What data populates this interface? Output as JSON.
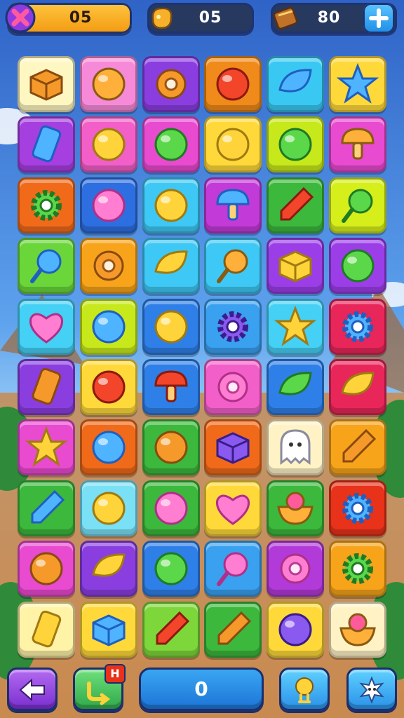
{
  "hud": {
    "lives_value": "05",
    "moves_value": "05",
    "coins_value": "80",
    "lives_icon": "close-x-icon",
    "moves_icon": "candy-bag-icon",
    "coins_icon": "chest-icon",
    "add_icon": "plus-icon"
  },
  "colors": {
    "hud_frame": "#1d3373",
    "hud_orange": "#f7a41a",
    "hud_dark": "#27395f",
    "add_blue": "#2fa3f0",
    "sky": "#3e79d6",
    "ground": "#c98a4f"
  },
  "board": {
    "rows": 10,
    "cols": 6,
    "tiles": [
      {
        "bg": "#fff7c2",
        "icon": "orange-cube-icon"
      },
      {
        "bg": "#f78ad8",
        "icon": "swirl-shell-icon"
      },
      {
        "bg": "#8a3ee0",
        "icon": "orange-spiral-icon"
      },
      {
        "bg": "#f08a1a",
        "icon": "red-ball-icon"
      },
      {
        "bg": "#39c8f2",
        "icon": "blue-droplet-icon"
      },
      {
        "bg": "#ffd93a",
        "icon": "blue-star-icon"
      },
      {
        "bg": "#a63fe0",
        "icon": "blue-phone-icon"
      },
      {
        "bg": "#f25fc8",
        "icon": "yellow-blob-icon"
      },
      {
        "bg": "#e84ad0",
        "icon": "green-chip-icon"
      },
      {
        "bg": "#ffd93a",
        "icon": "yellow-slime-icon"
      },
      {
        "bg": "#c7e81a",
        "icon": "green-apple-icon"
      },
      {
        "bg": "#e84ad0",
        "icon": "mushroom-stool-icon"
      },
      {
        "bg": "#f06a1a",
        "icon": "green-gear-icon"
      },
      {
        "bg": "#2d6fe0",
        "icon": "pink-onion-icon"
      },
      {
        "bg": "#3ec8f5",
        "icon": "yellow-cat-icon"
      },
      {
        "bg": "#c23ad8",
        "icon": "blue-mushroom-icon"
      },
      {
        "bg": "#3cb83c",
        "icon": "red-cone-icon"
      },
      {
        "bg": "#d6ee1a",
        "icon": "green-lollipop-icon"
      },
      {
        "bg": "#6ad63a",
        "icon": "blue-lollipop-icon"
      },
      {
        "bg": "#f7a41a",
        "icon": "donut-icon"
      },
      {
        "bg": "#3ec8f5",
        "icon": "banana-icon"
      },
      {
        "bg": "#3ec8f5",
        "icon": "magnifier-icon"
      },
      {
        "bg": "#9b3ee8",
        "icon": "yellow-box-icon"
      },
      {
        "bg": "#9b3ee8",
        "icon": "green-gem-icon"
      },
      {
        "bg": "#45d0f5",
        "icon": "pink-heart-icon"
      },
      {
        "bg": "#c7e81a",
        "icon": "blue-orb-icon"
      },
      {
        "bg": "#2f7fe8",
        "icon": "yellow-fruit-icon"
      },
      {
        "bg": "#3aa0f0",
        "icon": "purple-gear-icon"
      },
      {
        "bg": "#45d0f5",
        "icon": "yellow-star-blob-icon"
      },
      {
        "bg": "#e8265a",
        "icon": "blue-cog-cluster-icon"
      },
      {
        "bg": "#8a3ee0",
        "icon": "orange-phone-icon"
      },
      {
        "bg": "#ffd93a",
        "icon": "red-flower-icon"
      },
      {
        "bg": "#2f7fe8",
        "icon": "red-mushroom-icon"
      },
      {
        "bg": "#f25fc8",
        "icon": "pink-ring-icon"
      },
      {
        "bg": "#2f7fe8",
        "icon": "green-leaf-icon"
      },
      {
        "bg": "#e8265a",
        "icon": "lemon-icon"
      },
      {
        "bg": "#e84ad0",
        "icon": "smiling-star-icon"
      },
      {
        "bg": "#f06a1a",
        "icon": "blue-crystal-icon"
      },
      {
        "bg": "#3cb83c",
        "icon": "orange-coin-icon"
      },
      {
        "bg": "#f06a1a",
        "icon": "purple-bar-icon"
      },
      {
        "bg": "#fff3c6",
        "icon": "ghost-icon"
      },
      {
        "bg": "#f7a41a",
        "icon": "ice-cream-cone-icon"
      },
      {
        "bg": "#3cb83c",
        "icon": "blue-wand-icon"
      },
      {
        "bg": "#79e0f5",
        "icon": "yellow-sun-icon"
      },
      {
        "bg": "#3cb83c",
        "icon": "pink-gumball-icon"
      },
      {
        "bg": "#ffd93a",
        "icon": "pink-heart-box-icon"
      },
      {
        "bg": "#3cb83c",
        "icon": "cupcake-icon"
      },
      {
        "bg": "#e8321a",
        "icon": "blue-cog-icon"
      },
      {
        "bg": "#e84ad0",
        "icon": "acorn-icon"
      },
      {
        "bg": "#8a3ee0",
        "icon": "yellow-lemon-icon"
      },
      {
        "bg": "#2f7fe8",
        "icon": "green-berry-icon"
      },
      {
        "bg": "#3aa0f0",
        "icon": "pink-magnifier-icon"
      },
      {
        "bg": "#b23ad8",
        "icon": "pink-donut-ring-icon"
      },
      {
        "bg": "#f7a41a",
        "icon": "green-gear-2-icon"
      },
      {
        "bg": "#fff3a8",
        "icon": "note-card-icon"
      },
      {
        "bg": "#ffd93a",
        "icon": "blue-cube-icon"
      },
      {
        "bg": "#7dd63a",
        "icon": "red-rocket-icon"
      },
      {
        "bg": "#3cb83c",
        "icon": "waffle-cone-icon"
      },
      {
        "bg": "#ffd93a",
        "icon": "purple-berry-icon"
      },
      {
        "bg": "#fff3c6",
        "icon": "berry-bowl-icon"
      }
    ]
  },
  "footer": {
    "back_icon": "back-arrow-icon",
    "shuffle_icon": "shuffle-icon",
    "shuffle_badge": "H",
    "score_value": "0",
    "hint_icon": "bulb-icon",
    "settings_icon": "sparkle-creature-icon"
  }
}
